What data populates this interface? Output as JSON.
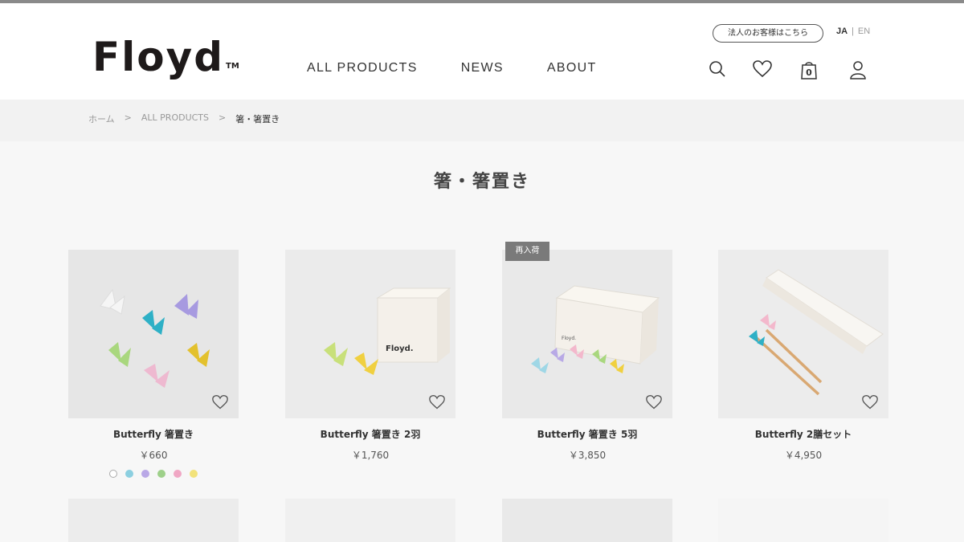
{
  "header": {
    "logo_text": "Floyd",
    "logo_tm": "TM",
    "nav": [
      "ALL PRODUCTS",
      "NEWS",
      "ABOUT"
    ],
    "corporate_link": "法人のお客様はこちら",
    "lang_ja": "JA",
    "lang_sep": "|",
    "lang_en": "EN",
    "icons": [
      "search-icon",
      "heart-icon",
      "cart-icon",
      "account-icon"
    ],
    "cart_count": "0"
  },
  "breadcrumb": [
    "ホーム",
    ">",
    "ALL PRODUCTS",
    ">",
    "箸・箸置き"
  ],
  "page_title": "箸・箸置き",
  "products": [
    {
      "name": "Butterfly 箸置き",
      "price": "￥660"
    },
    {
      "name": "Butterfly 箸置き 2羽",
      "price": "￥1,760"
    },
    {
      "name": "Butterfly 箸置き 5羽",
      "price": "￥3,850"
    },
    {
      "name": "Butterfly 2膳セット",
      "price": "￥4,950"
    }
  ],
  "badge": "再入荷",
  "swatch_colors": [
    "#ffffff",
    "#8ccfe0",
    "#b9a8e6",
    "#9ed08a",
    "#f0a7c4",
    "#f2e27a"
  ],
  "colors": {
    "brand": "#1e1a1a",
    "background": "#f7f7f7"
  }
}
